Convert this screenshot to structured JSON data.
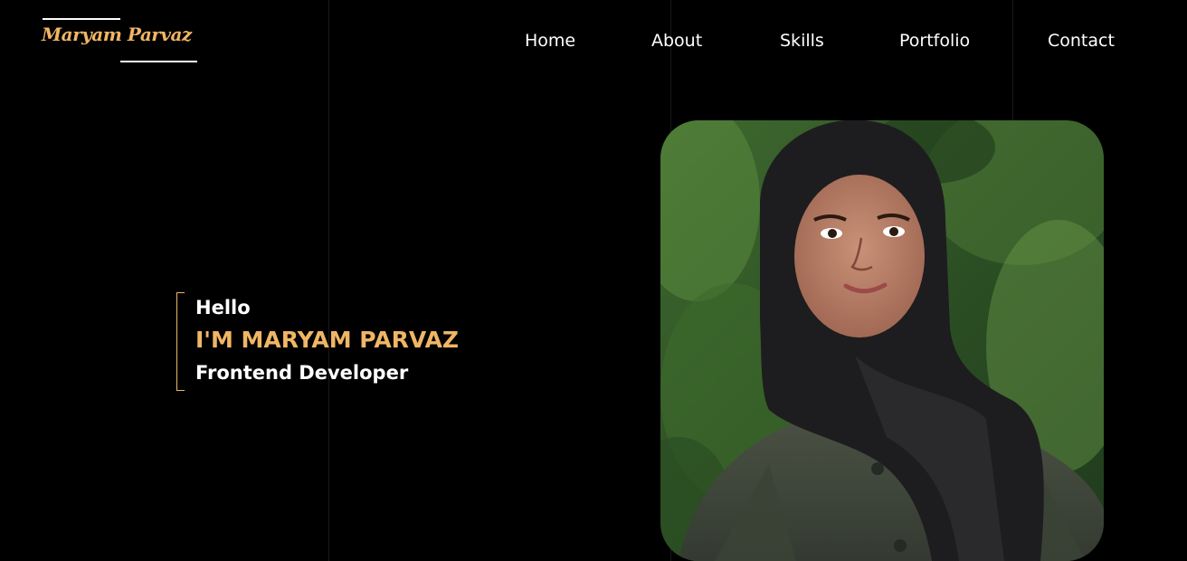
{
  "colors": {
    "accent": "#f0b665",
    "background": "#000000",
    "text": "#ffffff"
  },
  "logo": {
    "text": "Maryam Parvaz"
  },
  "nav": {
    "items": [
      {
        "label": "Home"
      },
      {
        "label": "About"
      },
      {
        "label": "Skills"
      },
      {
        "label": "Portfolio"
      },
      {
        "label": "Contact"
      }
    ]
  },
  "hero": {
    "greeting": "Hello",
    "name": "I'M MARYAM PARVAZ",
    "role": "Frontend Developer"
  }
}
